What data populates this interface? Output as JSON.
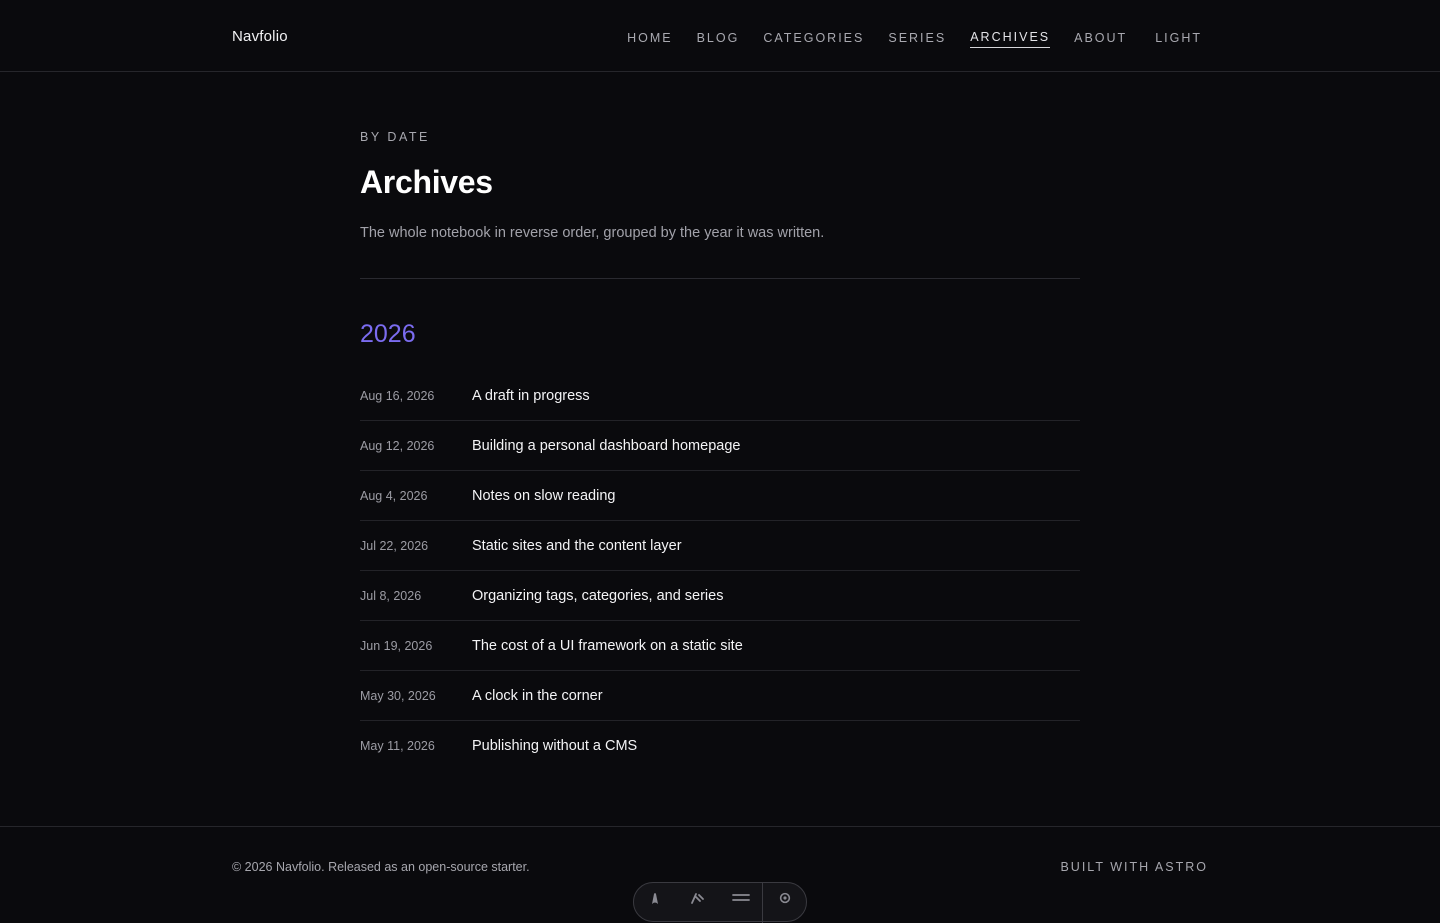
{
  "brand": "Navfolio",
  "nav": [
    {
      "label": "HOME",
      "active": false
    },
    {
      "label": "BLOG",
      "active": false
    },
    {
      "label": "CATEGORIES",
      "active": false
    },
    {
      "label": "SERIES",
      "active": false
    },
    {
      "label": "ARCHIVES",
      "active": true
    },
    {
      "label": "ABOUT",
      "active": false
    }
  ],
  "theme_toggle": "LIGHT",
  "page": {
    "eyebrow": "BY DATE",
    "title": "Archives",
    "description": "The whole notebook in reverse order, grouped by the year it was written."
  },
  "year": "2026",
  "posts": [
    {
      "date": "Aug 16, 2026",
      "title": "A draft in progress"
    },
    {
      "date": "Aug 12, 2026",
      "title": "Building a personal dashboard homepage"
    },
    {
      "date": "Aug 4, 2026",
      "title": "Notes on slow reading"
    },
    {
      "date": "Jul 22, 2026",
      "title": "Static sites and the content layer"
    },
    {
      "date": "Jul 8, 2026",
      "title": "Organizing tags, categories, and series"
    },
    {
      "date": "Jun 19, 2026",
      "title": "The cost of a UI framework on a static site"
    },
    {
      "date": "May 30, 2026",
      "title": "A clock in the corner"
    },
    {
      "date": "May 11, 2026",
      "title": "Publishing without a CMS"
    }
  ],
  "footer": {
    "copyright": "© 2026 Navfolio. Released as an open-source starter.",
    "built": "BUILT WITH ASTRO"
  },
  "toolbar": {
    "icons": [
      "astro-icon",
      "inspect-icon",
      "menu-icon",
      "settings-icon"
    ]
  },
  "colors": {
    "background": "#0a0a0d",
    "accent": "#7b6cf0",
    "text": "#f4f4f6",
    "muted": "#a2a2aa"
  }
}
